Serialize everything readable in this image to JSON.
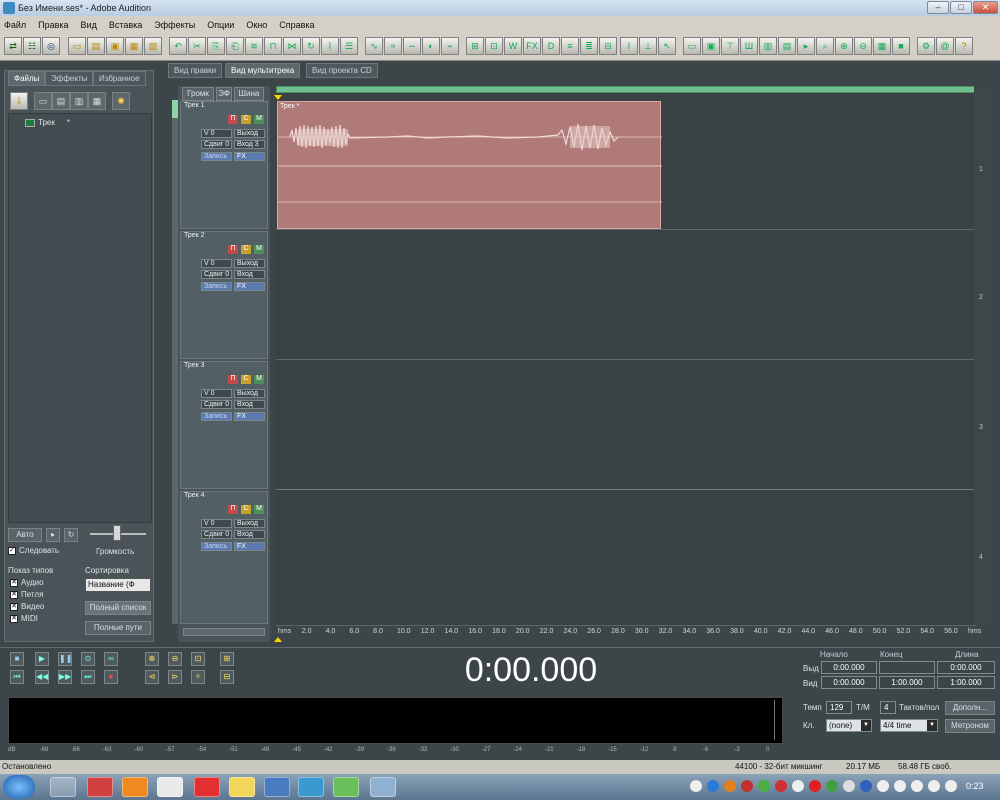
{
  "window": {
    "title": "Без Имени.ses* - Adobe Audition"
  },
  "menu": [
    "Файл",
    "Правка",
    "Вид",
    "Вставка",
    "Эффекты",
    "Опции",
    "Окно",
    "Справка"
  ],
  "view_tabs": [
    "Вид правки",
    "Вид мультитрека",
    "Вид проекта CD"
  ],
  "left_tabs": [
    "Файлы",
    "Эффекты",
    "Избранное"
  ],
  "files": [
    {
      "name": "Трек",
      "suffix": "*"
    }
  ],
  "left_controls": {
    "auto": "Авто",
    "loop": "Следовать",
    "volume": "Громкость"
  },
  "filter": {
    "title": "Показ типов",
    "items": [
      "Аудио",
      "Петля",
      "Видео",
      "MIDI"
    ]
  },
  "sort": {
    "title": "Сортировка",
    "value": "Название (Ф",
    "btn1": "Полный список",
    "btn2": "Полные пути"
  },
  "track_panel_tabs": [
    "Громк",
    "ЭФ",
    "Шина"
  ],
  "tracks": [
    {
      "name": "Трек 1",
      "vol": "V 0",
      "pan": "Сдвиг 0",
      "out": "Выход",
      "in": "Вход 3",
      "rec": "Запись",
      "fx": "FX"
    },
    {
      "name": "Трек 2",
      "vol": "V 0",
      "pan": "Сдвиг 0",
      "out": "Выход",
      "in": "Вход",
      "rec": "Запись",
      "fx": "FX"
    },
    {
      "name": "Трек 3",
      "vol": "V 0",
      "pan": "Сдвиг 0",
      "out": "Выход",
      "in": "Вход",
      "rec": "Запись",
      "fx": "FX"
    },
    {
      "name": "Трек 4",
      "vol": "V 0",
      "pan": "Сдвиг 0",
      "out": "Выход",
      "in": "Вход",
      "rec": "Запись",
      "fx": "FX"
    }
  ],
  "track_buttons": {
    "mute": "П",
    "solo": "С",
    "arm": "М"
  },
  "clip": {
    "label": "Трек *"
  },
  "track_numbers": [
    "1",
    "2",
    "3",
    "4"
  ],
  "ruler": [
    "hms",
    "2.0",
    "4.0",
    "6.0",
    "8.0",
    "10.0",
    "12.0",
    "14.0",
    "16.0",
    "18.0",
    "20.0",
    "22.0",
    "24.0",
    "26.0",
    "28.0",
    "30.0",
    "32.0",
    "34.0",
    "36.0",
    "38.0",
    "40.0",
    "42.0",
    "44.0",
    "46.0",
    "48.0",
    "50.0",
    "52.0",
    "54.0",
    "56.0",
    "hms"
  ],
  "time_display": "0:00.000",
  "selection": {
    "headers": [
      "Начало",
      "Конец",
      "Длина"
    ],
    "row_labels": [
      "Выд",
      "Вид"
    ],
    "sel": [
      "0:00.000",
      "",
      "0:00.000"
    ],
    "view": [
      "0:00.000",
      "1:00.000",
      "1:00.000"
    ]
  },
  "tempo": {
    "label": "Темп",
    "value": "129",
    "beats_label": "Т/М",
    "beats": "4",
    "bars_label": "Тактов/пол",
    "key_label": "Кл.",
    "key": "(none)",
    "time_sig": "4/4 time",
    "adv": "Дополн...",
    "metronome": "Метроном"
  },
  "level_scale": [
    "dB",
    "-69",
    "-66",
    "-63",
    "-60",
    "-57",
    "-54",
    "-51",
    "-48",
    "-45",
    "-42",
    "-39",
    "-36",
    "-33",
    "-30",
    "-27",
    "-24",
    "-21",
    "-18",
    "-15",
    "-12",
    "-9",
    "-6",
    "-3",
    "0"
  ],
  "status": {
    "left": "Остановлено",
    "rate": "44100 - 32-бит микшинг",
    "mem": "20.17 МБ",
    "disk": "58.48 ГБ своб."
  },
  "clock": "0:23",
  "colors": {
    "clip": "#b07a78",
    "overview": "#6fbf8c",
    "timer_bg": "#3c4548"
  }
}
